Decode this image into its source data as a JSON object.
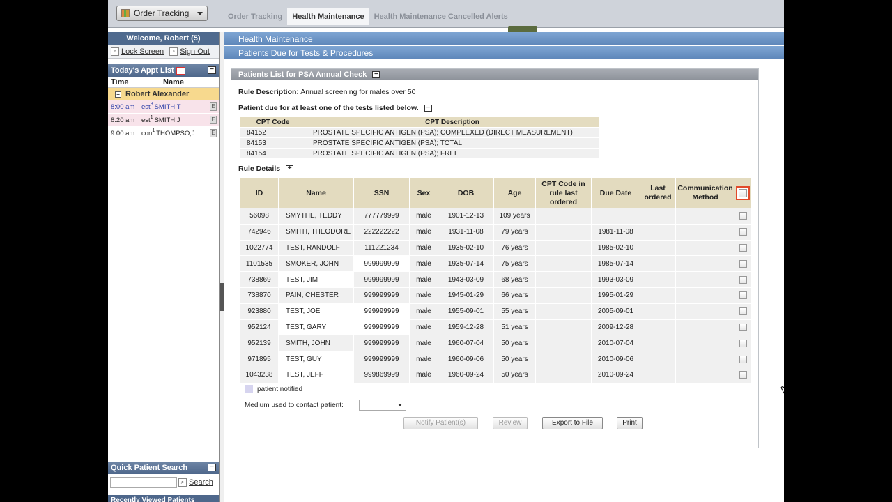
{
  "topbar": {
    "order_button": "Order Tracking",
    "tabs": [
      "Order Tracking",
      "Health Maintenance",
      "Health Maintenance Cancelled Alerts"
    ]
  },
  "left": {
    "welcome": "Welcome, Robert (5)",
    "lock_screen": "Lock Screen",
    "sign_out": "Sign Out",
    "appt_title": "Today's Appt List",
    "col_time": "Time",
    "col_name": "Name",
    "provider": "Robert Alexander",
    "appointments": [
      {
        "time": "8:00 am",
        "type": "est",
        "num": "3",
        "name": "SMITH,T",
        "flag": "E"
      },
      {
        "time": "8:20 am",
        "type": "est",
        "num": "1",
        "name": "SMITH,J",
        "flag": "E"
      },
      {
        "time": "9:00 am",
        "type": "con",
        "num": "1",
        "name": "THOMPSO,J",
        "flag": "E"
      }
    ],
    "quick_search_title": "Quick Patient Search",
    "search_label": "Search",
    "recent_title": "Recently Viewed Patients"
  },
  "main": {
    "header1": "Health Maintenance",
    "header2": "Patients Due for Tests & Procedures",
    "panel_title": "Patients List for PSA Annual Check",
    "rule_desc_label": "Rule Description:",
    "rule_desc_value": "Annual screening for males over 50",
    "due_title": "Patient due for at least one of the tests listed below.",
    "cpt_headers": [
      "CPT Code",
      "CPT Description"
    ],
    "cpt_rows": [
      {
        "code": "84152",
        "desc": "PROSTATE SPECIFIC ANTIGEN (PSA); COMPLEXED (DIRECT MEASUREMENT)"
      },
      {
        "code": "84153",
        "desc": "PROSTATE SPECIFIC ANTIGEN (PSA); TOTAL"
      },
      {
        "code": "84154",
        "desc": "PROSTATE SPECIFIC ANTIGEN (PSA); FREE"
      }
    ],
    "rule_details": "Rule Details",
    "table_headers": [
      "ID",
      "Name",
      "SSN",
      "Sex",
      "DOB",
      "Age",
      "CPT Code in rule last ordered",
      "Due Date",
      "Last ordered",
      "Communication Method"
    ],
    "patients": [
      {
        "id": "56098",
        "name": "SMYTHE, TEDDY",
        "ssn": "777779999",
        "sex": "male",
        "dob": "1901-12-13",
        "age": "109 years",
        "cpt": "",
        "due": "",
        "last": "",
        "comm": ""
      },
      {
        "id": "742946",
        "name": "SMITH, THEODORE",
        "ssn": "222222222",
        "sex": "male",
        "dob": "1931-11-08",
        "age": "79 years",
        "cpt": "",
        "due": "1981-11-08",
        "last": "",
        "comm": ""
      },
      {
        "id": "1022774",
        "name": "TEST, RANDOLF",
        "ssn": "111221234",
        "sex": "male",
        "dob": "1935-02-10",
        "age": "76 years",
        "cpt": "",
        "due": "1985-02-10",
        "last": "",
        "comm": ""
      },
      {
        "id": "1101535",
        "name": "SMOKER, JOHN",
        "ssn": "999999999",
        "sex": "male",
        "dob": "1935-07-14",
        "age": "75 years",
        "cpt": "",
        "due": "1985-07-14",
        "last": "",
        "comm": ""
      },
      {
        "id": "738869",
        "name": "TEST, JIM",
        "ssn": "999999999",
        "sex": "male",
        "dob": "1943-03-09",
        "age": "68 years",
        "cpt": "",
        "due": "1993-03-09",
        "last": "",
        "comm": ""
      },
      {
        "id": "738870",
        "name": "PAIN, CHESTER",
        "ssn": "999999999",
        "sex": "male",
        "dob": "1945-01-29",
        "age": "66 years",
        "cpt": "",
        "due": "1995-01-29",
        "last": "",
        "comm": ""
      },
      {
        "id": "923880",
        "name": "TEST, JOE",
        "ssn": "999999999",
        "sex": "male",
        "dob": "1955-09-01",
        "age": "55 years",
        "cpt": "",
        "due": "2005-09-01",
        "last": "",
        "comm": ""
      },
      {
        "id": "952124",
        "name": "TEST, GARY",
        "ssn": "999999999",
        "sex": "male",
        "dob": "1959-12-28",
        "age": "51 years",
        "cpt": "",
        "due": "2009-12-28",
        "last": "",
        "comm": ""
      },
      {
        "id": "952139",
        "name": "SMITH, JOHN",
        "ssn": "999999999",
        "sex": "male",
        "dob": "1960-07-04",
        "age": "50 years",
        "cpt": "",
        "due": "2010-07-04",
        "last": "",
        "comm": ""
      },
      {
        "id": "971895",
        "name": "TEST, GUY",
        "ssn": "999999999",
        "sex": "male",
        "dob": "1960-09-06",
        "age": "50 years",
        "cpt": "",
        "due": "2010-09-06",
        "last": "",
        "comm": ""
      },
      {
        "id": "1043238",
        "name": "TEST, JEFF",
        "ssn": "999869999",
        "sex": "male",
        "dob": "1960-09-24",
        "age": "50 years",
        "cpt": "",
        "due": "2010-09-24",
        "last": "",
        "comm": ""
      }
    ],
    "legend": "patient notified",
    "medium_label": "Medium used to contact patient:",
    "medium_value": "",
    "buttons": {
      "notify": "Notify Patient(s)",
      "review": "Review",
      "export": "Export to File",
      "print": "Print"
    }
  },
  "colors": {
    "accent": "#5d86b9",
    "highlight": "#e24a2a",
    "notified": "#d6d4ef"
  }
}
